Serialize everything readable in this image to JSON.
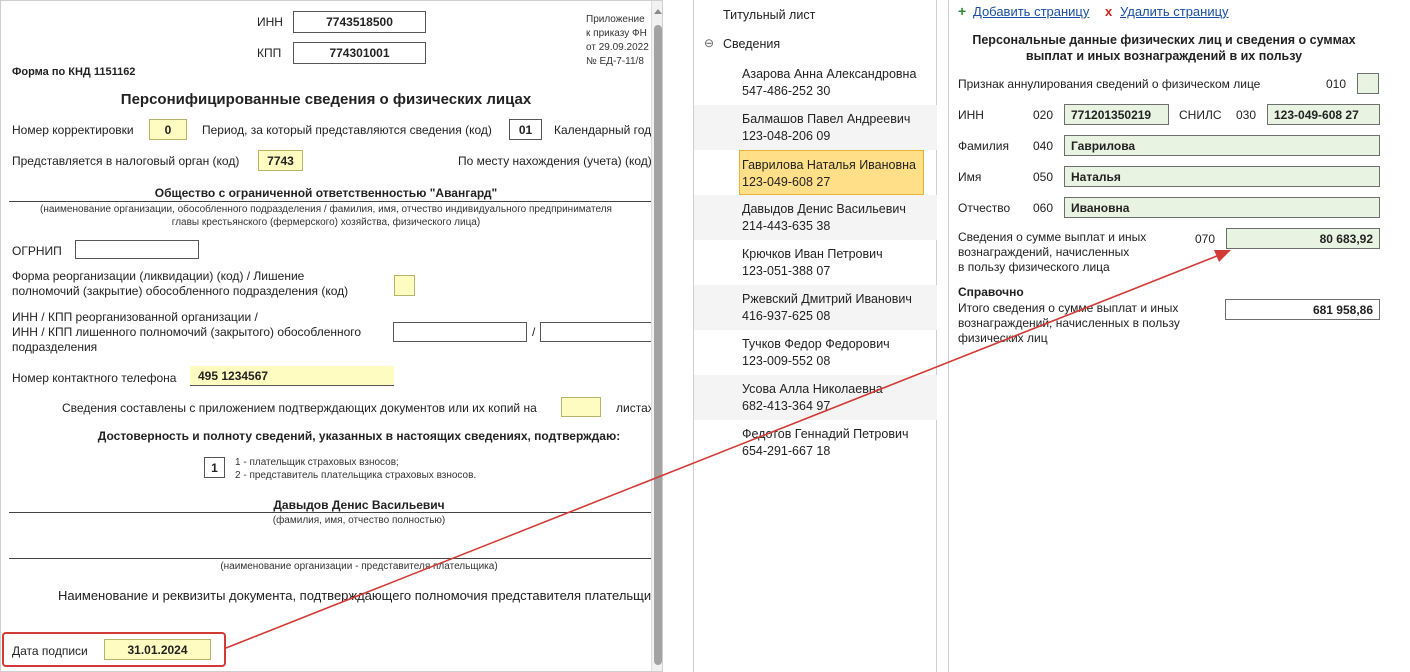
{
  "left_form": {
    "inn_label": "ИНН",
    "inn_value": "7743518500",
    "kpp_label": "КПП",
    "kpp_value": "774301001",
    "appendix_lines": [
      "Приложение",
      "к приказу ФН",
      "от 29.09.2022",
      "№ ЕД-7-11/8"
    ],
    "knd_label": "Форма по КНД 1151162",
    "title": "Персонифицированные сведения о физических лицах",
    "correction_label": "Номер корректировки",
    "correction_value": "0",
    "period_label": "Период, за который представляются сведения (код)",
    "period_value": "01",
    "calendar_label": "Календарный год",
    "tax_authority_label": "Представляется в налоговый орган (код)",
    "tax_authority_value": "7743",
    "location_label": "По месту нахождения (учета) (код)",
    "org_name": "Общество с ограниченной ответственностью \"Авангард\"",
    "org_caption_line1": "(наименование организации, обособленного подразделения / фамилия, имя, отчество индивидуального предпринимателя",
    "org_caption_line2": "главы крестьянского (фермерского) хозяйства, физического лица)",
    "ogrnip_label": "ОГРНИП",
    "reorg_label_line1": "Форма реорганизации (ликвидации) (код) / Лишение",
    "reorg_label_line2": "полномочий (закрытие) обособленного подразделения (код)",
    "reorg_inn_line1": "ИНН / КПП реорганизованной организации /",
    "reorg_inn_line2": "ИНН / КПП лишенного полномочий (закрытого) обособленного",
    "reorg_inn_line3": "подразделения",
    "slash": "/",
    "phone_label": "Номер контактного телефона",
    "phone_value": "495 1234567",
    "docs_label": "Сведения составлены с приложением подтверждающих документов или их копий на",
    "sheets_label": "листах",
    "confirm_heading": "Достоверность и полноту сведений, указанных в настоящих сведениях, подтверждаю:",
    "signer_code": "1",
    "signer_option1": "1 - плательщик страховых взносов;",
    "signer_option2": "2 - представитель плательщика страховых взносов.",
    "signer_name": "Давыдов Денис Васильевич",
    "signer_caption": "(фамилия, имя, отчество полностью)",
    "rep_caption": "(наименование организации - представителя плательщика)",
    "rep_doc_label": "Наименование и реквизиты документа, подтверждающего полномочия представителя плательщика",
    "sign_date_label": "Дата подписи",
    "sign_date_value": "31.01.2024"
  },
  "tree": {
    "title_sheet": "Титульный лист",
    "section_toggle": "⊖",
    "section_label": "Сведения",
    "people": [
      {
        "name": "Азарова Анна Александровна",
        "snils": "547-486-252 30"
      },
      {
        "name": "Балмашов Павел Андреевич",
        "snils": "123-048-206 09"
      },
      {
        "name": "Гаврилова Наталья Ивановна",
        "snils": "123-049-608 27"
      },
      {
        "name": "Давыдов Денис Васильевич",
        "snils": "214-443-635 38"
      },
      {
        "name": "Крючков Иван Петрович",
        "snils": "123-051-388 07"
      },
      {
        "name": "Ржевский Дмитрий Иванович",
        "snils": "416-937-625 08"
      },
      {
        "name": "Тучков Федор Федорович",
        "snils": "123-009-552 08"
      },
      {
        "name": "Усова Алла Николаевна",
        "snils": "682-413-364 97"
      },
      {
        "name": "Федотов Геннадий Петрович",
        "snils": "654-291-667 18"
      }
    ]
  },
  "right_form": {
    "add_icon": "+",
    "add_page": "Добавить страницу",
    "delete_icon": "x",
    "delete_page": "Удалить страницу",
    "heading_line1": "Персональные данные физических лиц и сведения о суммах",
    "heading_line2": "выплат и иных вознаграждений в их пользу",
    "annul_label": "Признак аннулирования сведений о физическом лице",
    "annul_code": "010",
    "inn_label": "ИНН",
    "inn_code": "020",
    "inn_value": "771201350219",
    "snils_label": "СНИЛС",
    "snils_code": "030",
    "snils_value": "123-049-608 27",
    "surname_label": "Фамилия",
    "surname_code": "040",
    "surname_value": "Гаврилова",
    "name_label": "Имя",
    "name_code": "050",
    "name_value": "Наталья",
    "patronymic_label": "Отчество",
    "patronymic_code": "060",
    "patronymic_value": "Ивановна",
    "payments_label_line1": "Сведения о сумме выплат и иных",
    "payments_label_line2": "вознаграждений, начисленных",
    "payments_label_line3": "в пользу физического лица",
    "payments_code": "070",
    "payments_value": "80 683,92",
    "reference_heading": "Справочно",
    "total_label_line1": "Итого сведения о сумме выплат и иных",
    "total_label_line2": "вознаграждений, начисленных в пользу",
    "total_label_line3": "физических лиц",
    "total_value": "681 958,86"
  },
  "colors": {
    "highlight_red": "#d23b35",
    "selected_item": "#ffdf87",
    "yellow_field": "#fffcc2",
    "green_field": "#e9f3e2",
    "link_blue": "#1a4fa0"
  }
}
